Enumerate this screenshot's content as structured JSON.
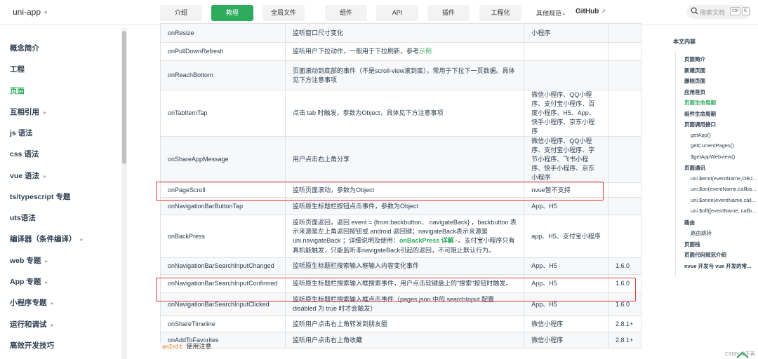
{
  "brand": {
    "name": "uni-app",
    "caret": "▾"
  },
  "nav": {
    "buttons": [
      "介绍",
      "教程",
      "全局文件",
      "组件",
      "API",
      "插件",
      "工程化"
    ],
    "more": "其他规范",
    "more_caret": "▸",
    "github": "GitHub",
    "external_icon": "↗"
  },
  "search": {
    "placeholder": "搜索文档",
    "key1": "ctrl",
    "key2": "K"
  },
  "sidebar": {
    "items": [
      {
        "label": "概念简介",
        "arrow": ""
      },
      {
        "label": "工程",
        "arrow": ""
      },
      {
        "label": "页面",
        "arrow": ""
      },
      {
        "label": "互相引用",
        "arrow": "▸"
      },
      {
        "label": "js 语法",
        "arrow": ""
      },
      {
        "label": "css 语法",
        "arrow": ""
      },
      {
        "label": "vue 语法",
        "arrow": "▸"
      },
      {
        "label": "ts/typescript 专题",
        "arrow": ""
      },
      {
        "label": "uts语法",
        "arrow": ""
      },
      {
        "label": "编译器（条件编译）",
        "arrow": "▸"
      },
      {
        "label": "web 专题",
        "arrow": "▸"
      },
      {
        "label": "App 专题",
        "arrow": "▸"
      },
      {
        "label": "小程序专题",
        "arrow": "▸"
      },
      {
        "label": "运行和调试",
        "arrow": "▸"
      },
      {
        "label": "高效开发技巧",
        "arrow": ""
      }
    ],
    "active_index": 2
  },
  "table": {
    "rows": [
      {
        "name": "onResize",
        "desc": "监听窗口尺寸变化",
        "platform": "小程序",
        "version": ""
      },
      {
        "name": "onPullDownRefresh",
        "desc": "监听用户下拉动作，一般用于下拉刷新，参考",
        "desc_link": "示例",
        "platform": "",
        "version": ""
      },
      {
        "name": "onReachBottom",
        "desc": "页面滚动到底部的事件（不是scroll-view滚到底），常用于下拉下一页数据。具体见下方注意事项",
        "platform": "",
        "version": ""
      },
      {
        "name": "onTabItemTap",
        "desc": "点击 tab 时触发，参数为Object，具体见下方注意事项",
        "platform": "微信小程序、QQ小程序、支付宝小程序、百度小程序、H5、App、快手小程序、京东小程序",
        "version": ""
      },
      {
        "name": "onShareAppMessage",
        "desc": "用户点击右上角分享",
        "platform": "微信小程序、QQ小程序、支付宝小程序、字节小程序、飞书小程序、快手小程序、京东小程序",
        "version": ""
      },
      {
        "name": "onPageScroll",
        "desc": "监听页面滚动，参数为Object",
        "platform": "nvue暂不支持",
        "version": ""
      },
      {
        "name": "onNavigationBarButtonTap",
        "desc": "监听原生标题栏按钮点击事件，参数为Object",
        "platform": "App、H5",
        "version": ""
      },
      {
        "name": "onBackPress",
        "desc": "监听页面返回，返回 event = {from:backbutton、 navigateBack} ，backbutton 表示来源是左上角返回按钮或 android 返回键；navigateBack表示来源是 uni.navigateBack ；详细说明及使用：",
        "desc_link": "onBackPress 详解",
        "desc_after": "。支付宝小程序只有真机能触发，只能监听非navigateBack引起的返回，不可阻止默认行为。",
        "platform": "app、H5、支付宝小程序",
        "version": ""
      },
      {
        "name": "onNavigationBarSearchInputChanged",
        "desc": "监听原生标题栏搜索输入框输入内容变化事件",
        "platform": "App、H5",
        "version": "1.6.0"
      },
      {
        "name": "onNavigationBarSearchInputConfirmed",
        "desc": "监听原生标题栏搜索输入框搜索事件，用户点击软键盘上的\"搜索\"按钮时触发。",
        "platform": "App、H5",
        "version": "1.6.0"
      },
      {
        "name": "onNavigationBarSearchInputClicked",
        "desc": "监听原生标题栏搜索输入框点击事件（pages.json 中的 searchInput 配置 disabled 为 true 时才会触发）",
        "platform": "App、H5",
        "version": "1.6.0"
      },
      {
        "name": "onShareTimeline",
        "desc": "监听用户点击右上角转发到朋友圈",
        "platform": "微信小程序",
        "version": "2.8.1+"
      },
      {
        "name": "onAddToFavorites",
        "desc": "监听用户点击右上角收藏",
        "platform": "微信小程序",
        "version": "2.8.1+"
      }
    ]
  },
  "note": {
    "code": "onInit",
    "text": "使用注意"
  },
  "toc": {
    "title": "本文内容",
    "items": [
      {
        "label": "页面简介",
        "level": 1
      },
      {
        "label": "新建页面",
        "level": 1
      },
      {
        "label": "删除页面",
        "level": 1
      },
      {
        "label": "应用首页",
        "level": 1
      },
      {
        "label": "页面生命周期",
        "level": 1
      },
      {
        "label": "组件生命周期",
        "level": 1
      },
      {
        "label": "页面调用接口",
        "level": 1
      },
      {
        "label": "getApp()",
        "level": 2
      },
      {
        "label": "getCurrentPages()",
        "level": 2
      },
      {
        "label": "$getAppWebview()",
        "level": 2
      },
      {
        "label": "页面通讯",
        "level": 1
      },
      {
        "label": "uni.$emit(eventName,OBJ...",
        "level": 2
      },
      {
        "label": "uni.$on(eventName,callba...",
        "level": 2
      },
      {
        "label": "uni.$once(eventName,call...",
        "level": 2
      },
      {
        "label": "uni.$off([eventName, callb...",
        "level": 2
      },
      {
        "label": "路由",
        "level": 1
      },
      {
        "label": "路由跳转",
        "level": 2
      },
      {
        "label": "页面栈",
        "level": 1
      },
      {
        "label": "页面代码规范介绍",
        "level": 1
      },
      {
        "label": "nvue 开发与 vue 开发的常...",
        "level": 1
      }
    ],
    "active_index": 4
  },
  "watermark": "CSDN @不再",
  "colors": {
    "accent": "#2fab5e",
    "highlight_box": "#e03a3a"
  }
}
